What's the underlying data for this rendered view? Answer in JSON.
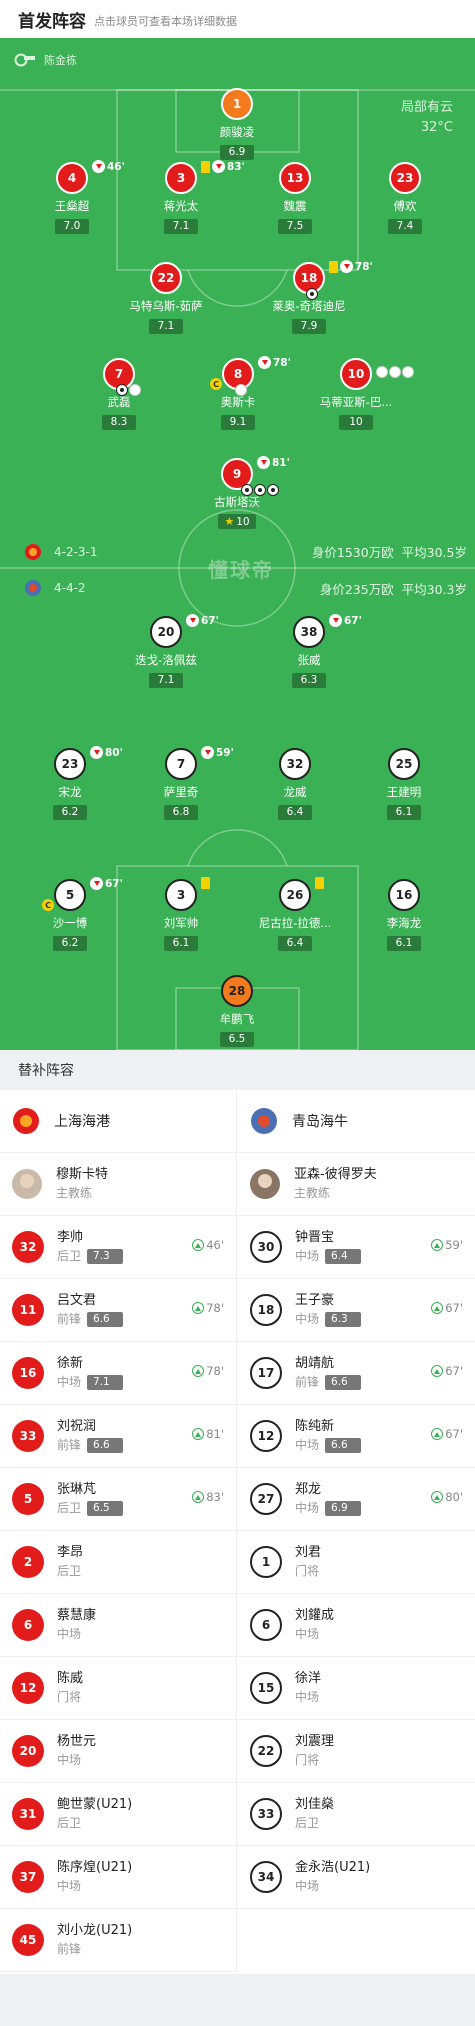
{
  "header": {
    "title": "首发阵容",
    "subtitle": "点击球员可查看本场详细数据"
  },
  "referee": {
    "name": "陈金栋"
  },
  "weather": {
    "condition": "局部有云",
    "temperature": "32°C"
  },
  "home_team": {
    "name": "上海海港",
    "formation": "4-2-3-1",
    "value": "身价1530万欧",
    "avg_age": "平均30.5岁",
    "color": "#e21b1b",
    "players": [
      {
        "num": "1",
        "name": "颜骏凌",
        "rating": "6.9",
        "gk": true
      },
      {
        "num": "4",
        "name": "王燊超",
        "rating": "7.0",
        "sub_off": "46'"
      },
      {
        "num": "3",
        "name": "蒋光太",
        "rating": "7.1",
        "yellow": true,
        "sub_off": "83'"
      },
      {
        "num": "13",
        "name": "魏震",
        "rating": "7.5"
      },
      {
        "num": "23",
        "name": "傅欢",
        "rating": "7.4"
      },
      {
        "num": "22",
        "name": "马特乌斯-茹萨",
        "rating": "7.1"
      },
      {
        "num": "18",
        "name": "莱奥-奇塔迪尼",
        "rating": "7.9",
        "yellow": true,
        "sub_off": "78'",
        "goals": 1
      },
      {
        "num": "7",
        "name": "武磊",
        "rating": "8.3",
        "goals": 1,
        "assists": 1
      },
      {
        "num": "8",
        "name": "奥斯卡",
        "rating": "9.1",
        "sub_off": "78'",
        "captain": true,
        "assists": 1
      },
      {
        "num": "10",
        "name": "马蒂亚斯-巴...",
        "rating": "10",
        "assists": 3
      },
      {
        "num": "9",
        "name": "古斯塔沃",
        "rating": "10",
        "sub_off": "81'",
        "goals": 3,
        "mvp": true
      }
    ]
  },
  "away_team": {
    "name": "青岛海牛",
    "formation": "4-4-2",
    "value": "身价235万欧",
    "avg_age": "平均30.3岁",
    "color": "#ffffff",
    "players": [
      {
        "num": "20",
        "name": "迭戈-洛佩兹",
        "rating": "7.1",
        "sub_off": "67'"
      },
      {
        "num": "38",
        "name": "张威",
        "rating": "6.3",
        "sub_off": "67'"
      },
      {
        "num": "23",
        "name": "宋龙",
        "rating": "6.2",
        "sub_off": "80'"
      },
      {
        "num": "7",
        "name": "萨里奇",
        "rating": "6.8",
        "sub_off": "59'"
      },
      {
        "num": "32",
        "name": "龙威",
        "rating": "6.4"
      },
      {
        "num": "25",
        "name": "王建明",
        "rating": "6.1"
      },
      {
        "num": "5",
        "name": "沙一博",
        "rating": "6.2",
        "sub_off": "67'",
        "captain": true
      },
      {
        "num": "3",
        "name": "刘军帅",
        "rating": "6.1",
        "yellow": true
      },
      {
        "num": "26",
        "name": "尼古拉-拉德...",
        "rating": "6.4",
        "yellow": true
      },
      {
        "num": "16",
        "name": "李海龙",
        "rating": "6.1"
      },
      {
        "num": "28",
        "name": "牟鹏飞",
        "rating": "6.5",
        "gk": true
      }
    ]
  },
  "watermark": "懂球帝",
  "bench_title": "替补阵容",
  "bench": {
    "home": {
      "team": "上海海港",
      "coach": {
        "name": "穆斯卡特",
        "role": "主教练"
      },
      "players": [
        {
          "num": "32",
          "name": "李帅",
          "pos": "后卫",
          "rating": "7.3",
          "in": "46'"
        },
        {
          "num": "11",
          "name": "吕文君",
          "pos": "前锋",
          "rating": "6.6",
          "in": "78'"
        },
        {
          "num": "16",
          "name": "徐新",
          "pos": "中场",
          "rating": "7.1",
          "in": "78'"
        },
        {
          "num": "33",
          "name": "刘祝润",
          "pos": "前锋",
          "rating": "6.6",
          "in": "81'"
        },
        {
          "num": "5",
          "name": "张琳芃",
          "pos": "后卫",
          "rating": "6.5",
          "in": "83'"
        },
        {
          "num": "2",
          "name": "李昂",
          "pos": "后卫"
        },
        {
          "num": "6",
          "name": "蔡慧康",
          "pos": "中场"
        },
        {
          "num": "12",
          "name": "陈威",
          "pos": "门将"
        },
        {
          "num": "20",
          "name": "杨世元",
          "pos": "中场"
        },
        {
          "num": "31",
          "name": "鲍世蒙(U21)",
          "pos": "后卫"
        },
        {
          "num": "37",
          "name": "陈序煌(U21)",
          "pos": "中场"
        },
        {
          "num": "45",
          "name": "刘小龙(U21)",
          "pos": "前锋"
        }
      ]
    },
    "away": {
      "team": "青岛海牛",
      "coach": {
        "name": "亚森-彼得罗夫",
        "role": "主教练"
      },
      "players": [
        {
          "num": "30",
          "name": "钟晋宝",
          "pos": "中场",
          "rating": "6.4",
          "in": "59'"
        },
        {
          "num": "18",
          "name": "王子豪",
          "pos": "中场",
          "rating": "6.3",
          "in": "67'"
        },
        {
          "num": "17",
          "name": "胡靖航",
          "pos": "前锋",
          "rating": "6.6",
          "in": "67'"
        },
        {
          "num": "12",
          "name": "陈纯新",
          "pos": "中场",
          "rating": "6.6",
          "in": "67'"
        },
        {
          "num": "27",
          "name": "郑龙",
          "pos": "中场",
          "rating": "6.9",
          "in": "80'"
        },
        {
          "num": "1",
          "name": "刘君",
          "pos": "门将"
        },
        {
          "num": "6",
          "name": "刘鑵成",
          "pos": "中场"
        },
        {
          "num": "15",
          "name": "徐洋",
          "pos": "中场"
        },
        {
          "num": "22",
          "name": "刘震理",
          "pos": "门将"
        },
        {
          "num": "33",
          "name": "刘佳燊",
          "pos": "后卫"
        },
        {
          "num": "34",
          "name": "金永浩(U21)",
          "pos": "中场"
        }
      ]
    }
  }
}
